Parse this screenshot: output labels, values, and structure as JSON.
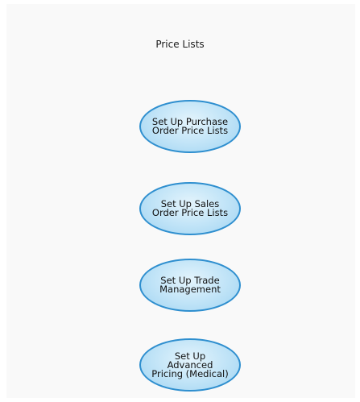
{
  "diagram": {
    "title": "Price Lists",
    "nodes": [
      {
        "label": "Set Up Purchase\nOrder Price Lists"
      },
      {
        "label": "Set Up Sales\nOrder Price Lists"
      },
      {
        "label": "Set Up Trade\nManagement"
      },
      {
        "label": "Set Up\nAdvanced\nPricing (Medical)"
      }
    ]
  }
}
